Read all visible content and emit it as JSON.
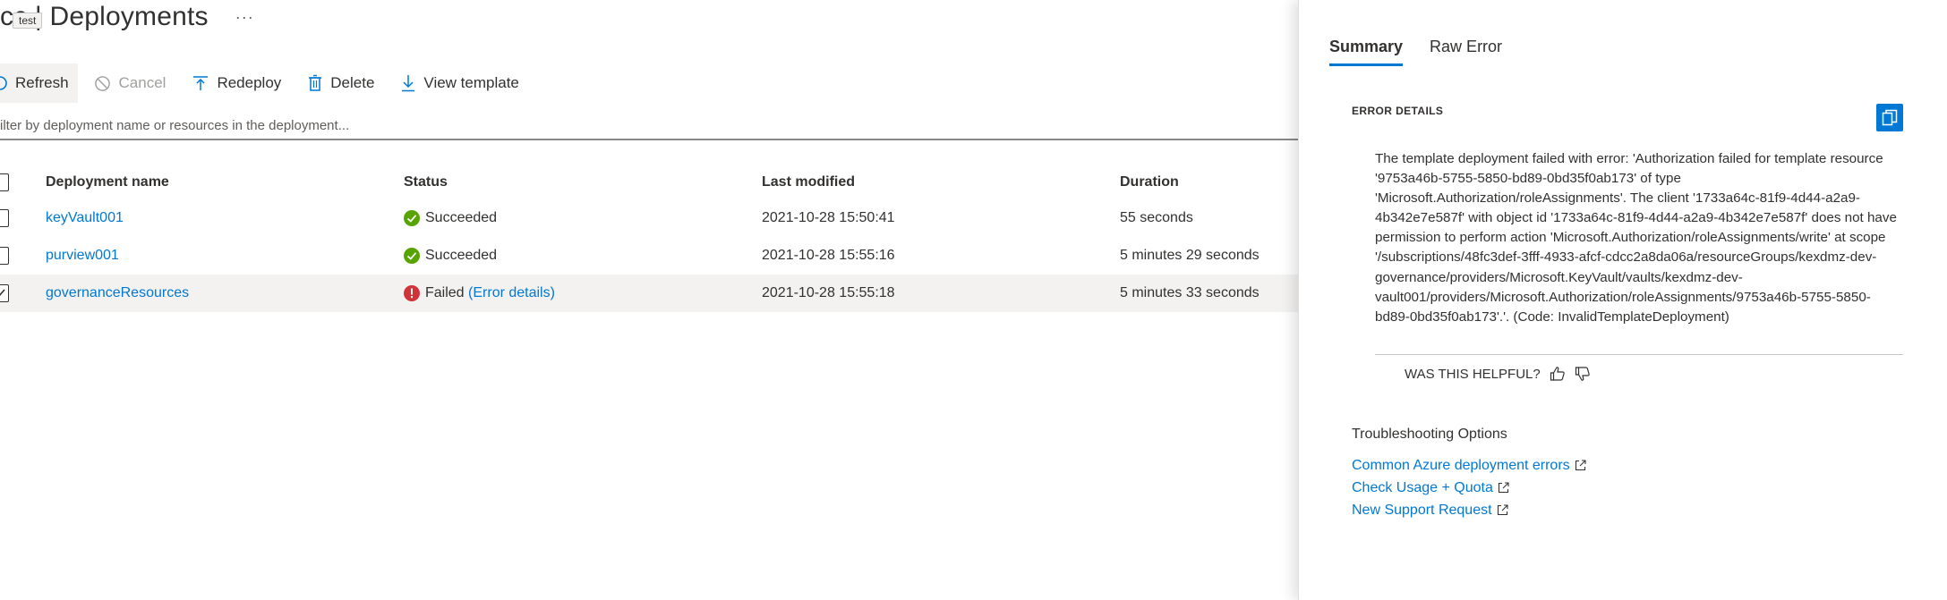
{
  "header": {
    "title": "cc | Deployments",
    "more_label": "···",
    "tooltip": "test"
  },
  "toolbar": {
    "refresh": "Refresh",
    "cancel": "Cancel",
    "redeploy": "Redeploy",
    "delete": "Delete",
    "view_template": "View template"
  },
  "filter": {
    "placeholder": "ilter by deployment name or resources in the deployment..."
  },
  "table": {
    "headers": {
      "name": "Deployment name",
      "status": "Status",
      "modified": "Last modified",
      "duration": "Duration"
    },
    "rows": [
      {
        "name": "keyVault001",
        "status": "Succeeded",
        "status_link": "",
        "modified": "2021-10-28 15:50:41",
        "duration": "55 seconds"
      },
      {
        "name": "purview001",
        "status": "Succeeded",
        "status_link": "",
        "modified": "2021-10-28 15:55:16",
        "duration": "5 minutes 29 seconds"
      },
      {
        "name": "governanceResources",
        "status": "Failed",
        "status_link": "(Error details)",
        "modified": "2021-10-28 15:55:18",
        "duration": "5 minutes 33 seconds"
      }
    ]
  },
  "panel": {
    "tabs": [
      "Summary",
      "Raw Error"
    ],
    "section_label": "ERROR DETAILS",
    "error_text": "The template deployment failed with error: 'Authorization failed for template resource '9753a46b-5755-5850-bd89-0bd35f0ab173' of type 'Microsoft.Authorization/roleAssignments'. The client '1733a64c-81f9-4d44-a2a9-4b342e7e587f' with object id '1733a64c-81f9-4d44-a2a9-4b342e7e587f' does not have permission to perform action 'Microsoft.Authorization/roleAssignments/write' at scope '/subscriptions/48fc3def-3fff-4933-afcf-cdcc2a8da06a/resourceGroups/kexdmz-dev-governance/providers/Microsoft.KeyVault/vaults/kexdmz-dev-vault001/providers/Microsoft.Authorization/roleAssignments/9753a46b-5755-5850-bd89-0bd35f0ab173'.'. (Code: InvalidTemplateDeployment)",
    "helpful": "WAS THIS HELPFUL?",
    "troubleshooting_title": "Troubleshooting Options",
    "links": [
      "Common Azure deployment errors",
      "Check Usage + Quota",
      "New Support Request"
    ]
  },
  "colors": {
    "accent": "#0078d4",
    "success": "#57a300",
    "error": "#d13438",
    "text": "#323130"
  }
}
